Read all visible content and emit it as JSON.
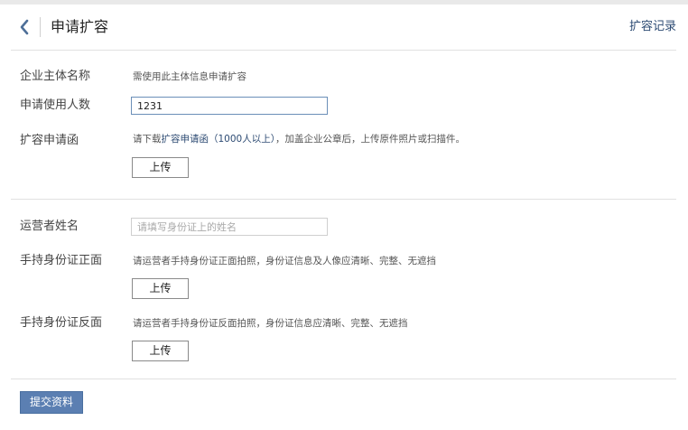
{
  "header": {
    "title": "申请扩容",
    "history_link": "扩容记录",
    "back_icon": "chevron-left-icon"
  },
  "form": {
    "company": {
      "label": "企业主体名称",
      "hint": "需使用此主体信息申请扩容"
    },
    "user_count": {
      "label": "申请使用人数",
      "value": "1231"
    },
    "letter": {
      "label": "扩容申请函",
      "hint_prefix": "请下载",
      "hint_link": "扩容申请函（1000人以上）",
      "hint_suffix": "，加盖企业公章后，上传原件照片或扫描件。",
      "upload_label": "上传"
    },
    "operator_name": {
      "label": "运营者姓名",
      "placeholder": "请填写身份证上的姓名"
    },
    "id_front": {
      "label": "手持身份证正面",
      "hint": "请运营者手持身份证正面拍照，身份证信息及人像应清晰、完整、无遮挡",
      "upload_label": "上传"
    },
    "id_back": {
      "label": "手持身份证反面",
      "hint": "请运营者手持身份证反面拍照，身份证信息应清晰、完整、无遮挡",
      "upload_label": "上传"
    },
    "submit_label": "提交资料"
  },
  "colors": {
    "accent": "#5b7fb2",
    "link": "#2d4b73",
    "focus_border": "#6b8fb8"
  }
}
